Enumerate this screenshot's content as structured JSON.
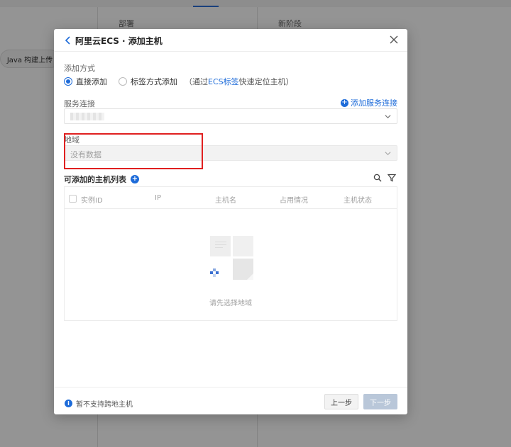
{
  "background": {
    "col_headers": [
      "部署",
      "新阶段"
    ],
    "chip_label": "Java 构建上传"
  },
  "modal": {
    "title": "阿里云ECS · 添加主机",
    "add_method": {
      "label": "添加方式",
      "options": [
        {
          "label": "直接添加",
          "checked": true
        },
        {
          "label": "标签方式添加",
          "checked": false
        }
      ],
      "hint_prefix": "（通过",
      "hint_link": "ECS标签",
      "hint_suffix": "快速定位主机）"
    },
    "service_connection": {
      "label": "服务连接",
      "add_link": "添加服务连接"
    },
    "region": {
      "label": "地域",
      "placeholder": "没有数据"
    },
    "host_list": {
      "title": "可添加的主机列表",
      "columns": [
        "实例ID",
        "IP",
        "主机名",
        "占用情况",
        "主机状态"
      ],
      "empty_text": "请先选择地域"
    },
    "footer": {
      "note": "暂不支持跨地主机",
      "prev_label": "上一步",
      "next_label": "下一步"
    }
  },
  "colors": {
    "primary": "#1d6bd9",
    "highlight": "#e02020",
    "disabled_button": "#b9c7d9"
  }
}
